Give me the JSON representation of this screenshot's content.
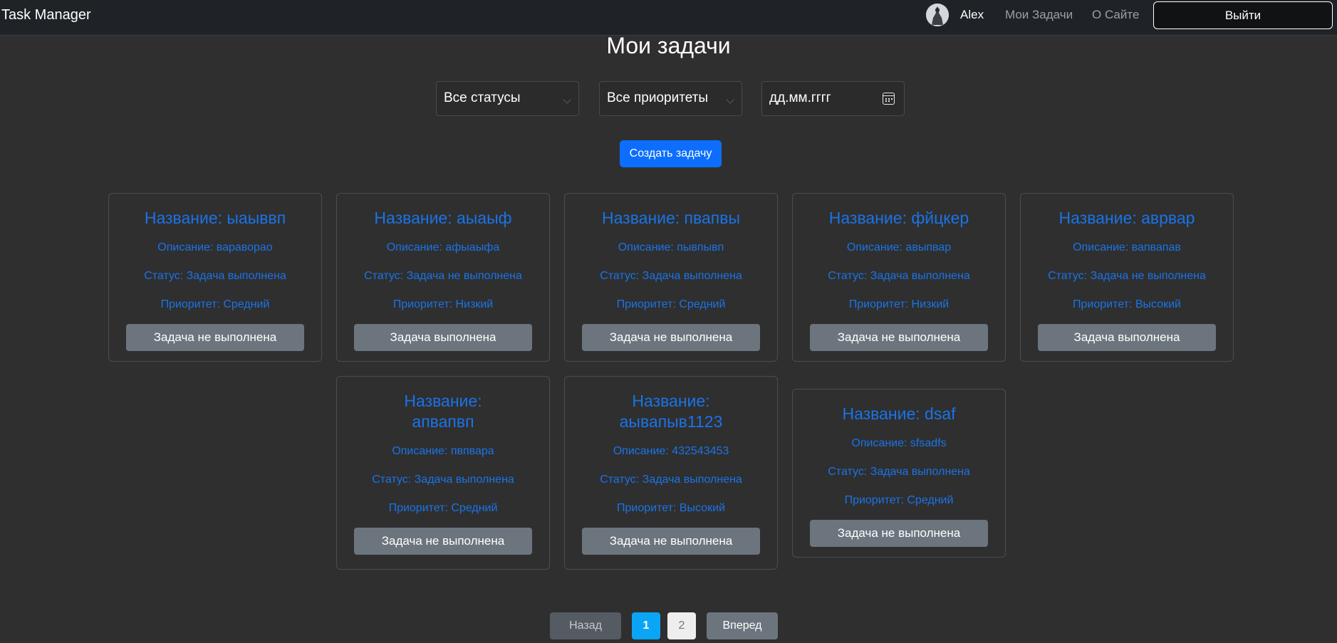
{
  "navbar": {
    "brand": "Task Manager",
    "username": "Alex",
    "links": [
      "Мои Задачи",
      "О Сайте"
    ],
    "logout": "Выйти"
  },
  "page": {
    "title": "Мои задачи",
    "filters": {
      "status": "Все статусы",
      "priority": "Все приоритеты",
      "date_placeholder": "дд.мм.гггг"
    },
    "create_button": "Создать задачу"
  },
  "tasks": [
    {
      "title": "Название: ыаыввп",
      "description": "Описание: вараворао",
      "status": "Статус: Задача выполнена",
      "priority": "Приоритет: Средний",
      "button": "Задача не выполнена"
    },
    {
      "title": "Название: аыаыф",
      "description": "Описание: афыаыфа",
      "status": "Статус: Задача не выполнена",
      "priority": "Приоритет: Низкий",
      "button": "Задача выполнена"
    },
    {
      "title": "Название: пвапвы",
      "description": "Описание: пывпывп",
      "status": "Статус: Задача выполнена",
      "priority": "Приоритет: Средний",
      "button": "Задача не выполнена"
    },
    {
      "title": "Название: фйцкер",
      "description": "Описание: авыпвар",
      "status": "Статус: Задача выполнена",
      "priority": "Приоритет: Низкий",
      "button": "Задача не выполнена"
    },
    {
      "title": "Название: аврвар",
      "description": "Описание: вапвапав",
      "status": "Статус: Задача не выполнена",
      "priority": "Приоритет: Высокий",
      "button": "Задача выполнена"
    },
    {
      "title": "Название: апвапвп",
      "description": "Описание: пвпвара",
      "status": "Статус: Задача выполнена",
      "priority": "Приоритет: Средний",
      "button": "Задача не выполнена"
    },
    {
      "title": "Название: аывапыв1123",
      "description": "Описание: 432543453",
      "status": "Статус: Задача выполнена",
      "priority": "Приоритет: Высокий",
      "button": "Задача не выполнена"
    },
    {
      "title": "Название: dsaf",
      "description": "Описание: sfsadfs",
      "status": "Статус: Задача выполнена",
      "priority": "Приоритет: Средний",
      "button": "Задача не выполнена"
    }
  ],
  "pagination": {
    "prev": "Назад",
    "pages": [
      "1",
      "2"
    ],
    "current": "1",
    "next": "Вперед"
  }
}
